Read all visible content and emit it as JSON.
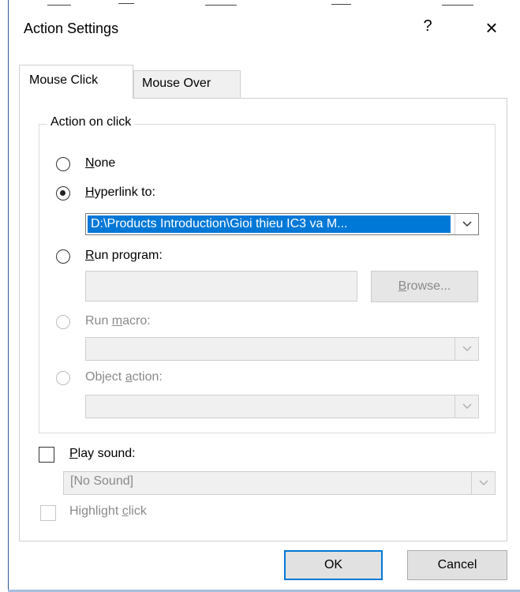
{
  "dialog": {
    "title": "Action Settings",
    "help_label": "?",
    "close_label": "×"
  },
  "tabs": [
    {
      "label": "Mouse Click",
      "active": true
    },
    {
      "label": "Mouse Over",
      "active": false
    }
  ],
  "group": {
    "legend": "Action on click",
    "options": {
      "none": {
        "label_ul": "N",
        "label_rest": "one",
        "checked": false,
        "enabled": true
      },
      "hyperlink": {
        "label_ul": "H",
        "label_rest": "yperlink to:",
        "checked": true,
        "enabled": true,
        "value": "D:\\Products Introduction\\Gioi thieu IC3 va M..."
      },
      "run_program": {
        "label_ul": "R",
        "label_rest": "un program:",
        "checked": false,
        "enabled": true,
        "value": "",
        "browse_ul": "B",
        "browse_rest": "rowse..."
      },
      "run_macro": {
        "label_pre": "Run ",
        "label_ul": "m",
        "label_rest": "acro:",
        "checked": false,
        "enabled": false,
        "value": ""
      },
      "object_action": {
        "label_pre": "Object ",
        "label_ul": "a",
        "label_rest": "ction:",
        "checked": false,
        "enabled": false,
        "value": ""
      }
    }
  },
  "play_sound": {
    "label_ul": "P",
    "label_rest": "lay sound:",
    "checked": false,
    "sound_value": "[No Sound]"
  },
  "highlight_click": {
    "label_pre": "Highlight ",
    "label_ul": "c",
    "label_rest": "lick",
    "checked": false,
    "enabled": false
  },
  "buttons": {
    "ok": "OK",
    "cancel": "Cancel"
  }
}
